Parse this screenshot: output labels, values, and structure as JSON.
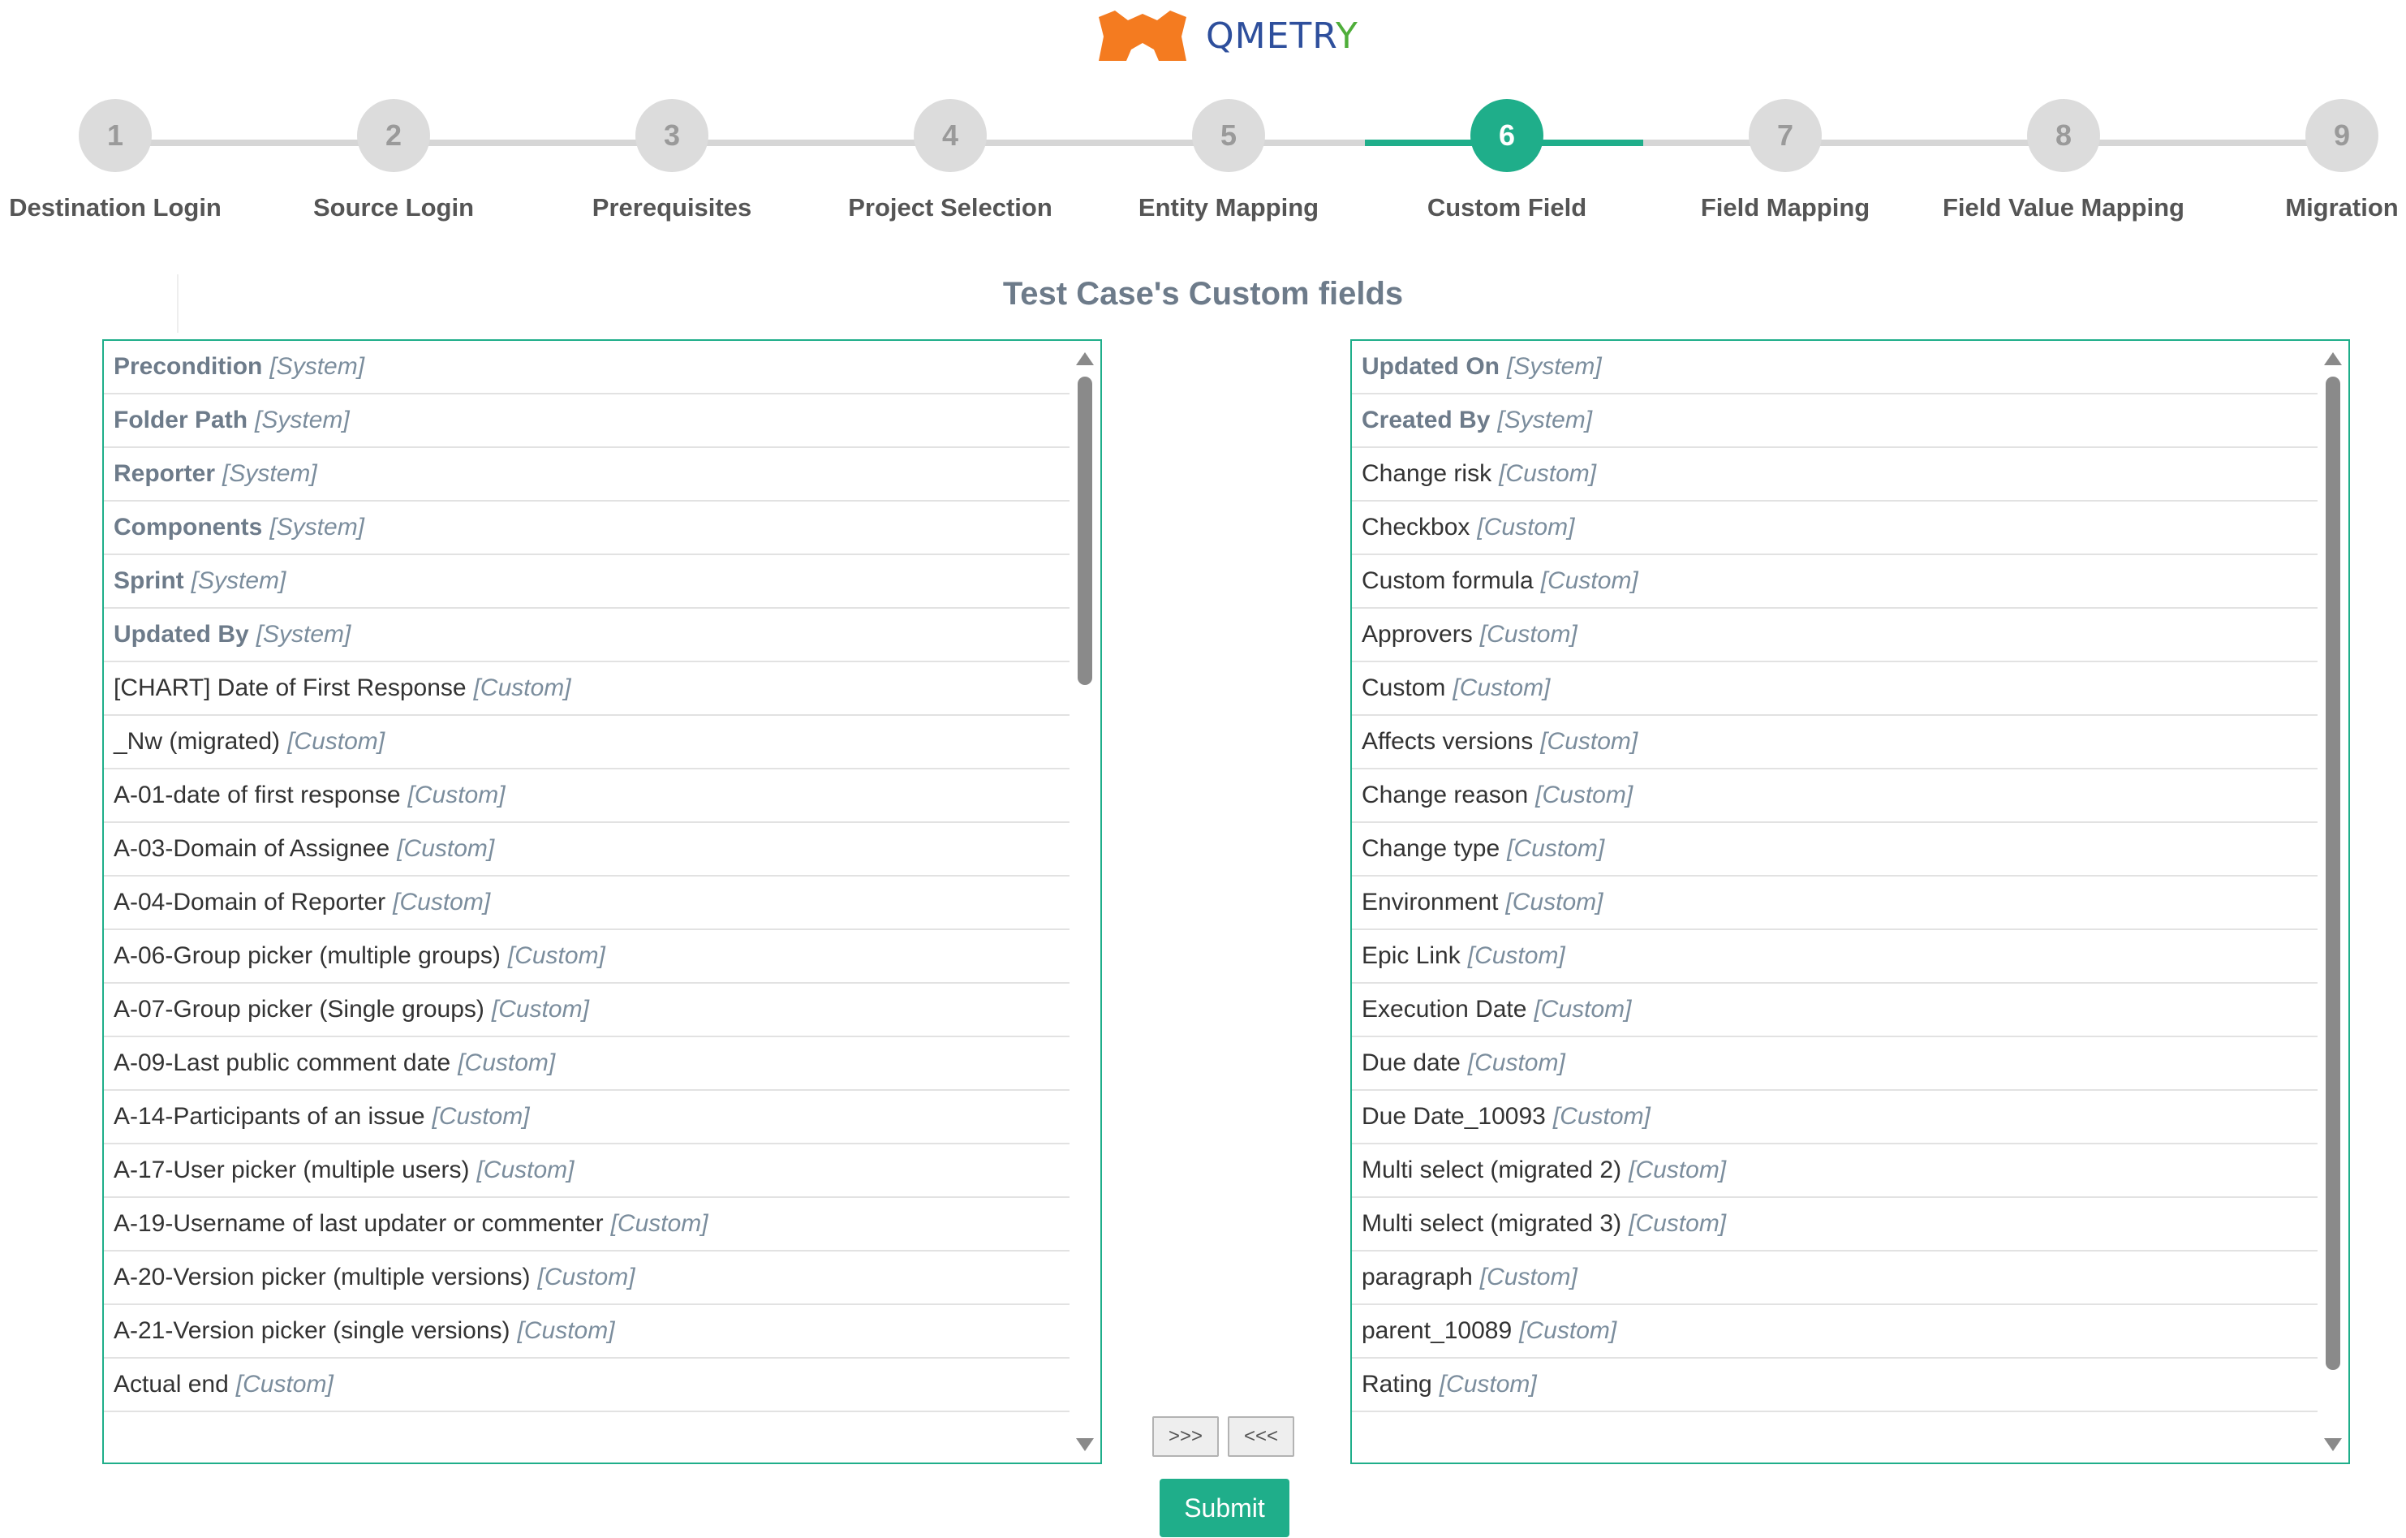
{
  "brand": {
    "logo_text": "QMETR",
    "logo_text_end": "Y"
  },
  "stepper": {
    "current_step": 6,
    "steps": [
      {
        "number": "1",
        "label": "Destination Login"
      },
      {
        "number": "2",
        "label": "Source Login"
      },
      {
        "number": "3",
        "label": "Prerequisites"
      },
      {
        "number": "4",
        "label": "Project Selection"
      },
      {
        "number": "5",
        "label": "Entity Mapping"
      },
      {
        "number": "6",
        "label": "Custom Field"
      },
      {
        "number": "7",
        "label": "Field Mapping"
      },
      {
        "number": "8",
        "label": "Field Value Mapping"
      },
      {
        "number": "9",
        "label": "Migration"
      }
    ]
  },
  "section": {
    "title": "Test Case's Custom fields"
  },
  "left_list": {
    "items": [
      {
        "name": "Precondition",
        "tag": "[System]",
        "system": true
      },
      {
        "name": "Folder Path",
        "tag": "[System]",
        "system": true
      },
      {
        "name": "Reporter",
        "tag": "[System]",
        "system": true
      },
      {
        "name": "Components",
        "tag": "[System]",
        "system": true
      },
      {
        "name": "Sprint",
        "tag": "[System]",
        "system": true
      },
      {
        "name": "Updated By",
        "tag": "[System]",
        "system": true
      },
      {
        "name": "[CHART] Date of First Response",
        "tag": "[Custom]",
        "system": false
      },
      {
        "name": "_Nw (migrated)",
        "tag": "[Custom]",
        "system": false
      },
      {
        "name": "A-01-date of first response",
        "tag": "[Custom]",
        "system": false
      },
      {
        "name": "A-03-Domain of Assignee",
        "tag": "[Custom]",
        "system": false
      },
      {
        "name": "A-04-Domain of Reporter",
        "tag": "[Custom]",
        "system": false
      },
      {
        "name": "A-06-Group picker (multiple groups)",
        "tag": "[Custom]",
        "system": false
      },
      {
        "name": "A-07-Group picker (Single groups)",
        "tag": "[Custom]",
        "system": false
      },
      {
        "name": "A-09-Last public comment date",
        "tag": "[Custom]",
        "system": false
      },
      {
        "name": "A-14-Participants of an issue",
        "tag": "[Custom]",
        "system": false
      },
      {
        "name": "A-17-User picker (multiple users)",
        "tag": "[Custom]",
        "system": false
      },
      {
        "name": "A-19-Username of last updater or commenter",
        "tag": "[Custom]",
        "system": false
      },
      {
        "name": "A-20-Version picker (multiple versions)",
        "tag": "[Custom]",
        "system": false
      },
      {
        "name": "A-21-Version picker (single versions)",
        "tag": "[Custom]",
        "system": false
      },
      {
        "name": "Actual end",
        "tag": "[Custom]",
        "system": false
      }
    ]
  },
  "right_list": {
    "items": [
      {
        "name": "Updated On",
        "tag": "[System]",
        "system": true
      },
      {
        "name": "Created By",
        "tag": "[System]",
        "system": true
      },
      {
        "name": "Change risk",
        "tag": "[Custom]",
        "system": false
      },
      {
        "name": "Checkbox",
        "tag": "[Custom]",
        "system": false
      },
      {
        "name": "Custom formula",
        "tag": "[Custom]",
        "system": false
      },
      {
        "name": "Approvers",
        "tag": "[Custom]",
        "system": false
      },
      {
        "name": "Custom",
        "tag": "[Custom]",
        "system": false
      },
      {
        "name": "Affects versions",
        "tag": "[Custom]",
        "system": false
      },
      {
        "name": "Change reason",
        "tag": "[Custom]",
        "system": false
      },
      {
        "name": "Change type",
        "tag": "[Custom]",
        "system": false
      },
      {
        "name": "Environment",
        "tag": "[Custom]",
        "system": false
      },
      {
        "name": "Epic Link",
        "tag": "[Custom]",
        "system": false
      },
      {
        "name": "Execution Date",
        "tag": "[Custom]",
        "system": false
      },
      {
        "name": "Due date",
        "tag": "[Custom]",
        "system": false
      },
      {
        "name": "Due Date_10093",
        "tag": "[Custom]",
        "system": false
      },
      {
        "name": "Multi select (migrated 2)",
        "tag": "[Custom]",
        "system": false
      },
      {
        "name": "Multi select (migrated 3)",
        "tag": "[Custom]",
        "system": false
      },
      {
        "name": "paragraph",
        "tag": "[Custom]",
        "system": false
      },
      {
        "name": "parent_10089",
        "tag": "[Custom]",
        "system": false
      },
      {
        "name": "Rating",
        "tag": "[Custom]",
        "system": false
      }
    ]
  },
  "actions": {
    "add_label": ">>>",
    "remove_label": "<<<",
    "submit_label": "Submit"
  },
  "colors": {
    "accent": "#1fae8a",
    "inactive_step": "#dcdcdc",
    "logo_orange": "#f47b20",
    "logo_blue": "#2e4f9c",
    "logo_green": "#4fae3a"
  }
}
